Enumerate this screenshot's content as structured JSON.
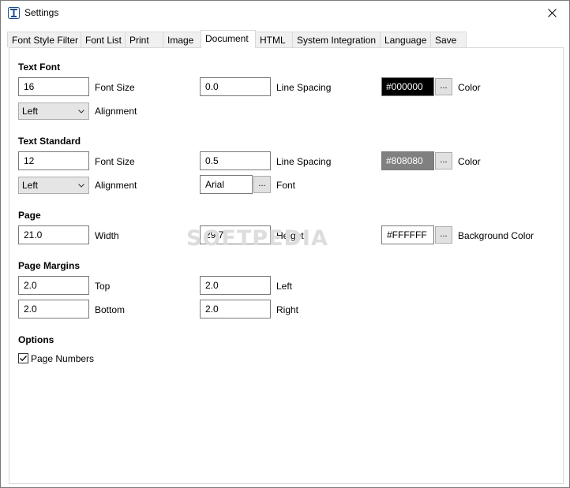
{
  "window": {
    "title": "Settings",
    "icon": "app-icon",
    "close_icon": "close-icon"
  },
  "tabs": [
    {
      "label": "Font Style Filter",
      "active": false
    },
    {
      "label": "Font List",
      "active": false
    },
    {
      "label": "Print",
      "active": false
    },
    {
      "label": "Image",
      "active": false
    },
    {
      "label": "Document",
      "active": true
    },
    {
      "label": "HTML",
      "active": false
    },
    {
      "label": "System Integration",
      "active": false
    },
    {
      "label": "Language",
      "active": false
    },
    {
      "label": "Save",
      "active": false
    }
  ],
  "text_font": {
    "title": "Text Font",
    "font_size": "16",
    "font_size_label": "Font Size",
    "line_spacing": "0.0",
    "line_spacing_label": "Line Spacing",
    "color": "#000000",
    "color_label": "Color",
    "alignment": "Left",
    "alignment_label": "Alignment",
    "ellipsis": "..."
  },
  "text_standard": {
    "title": "Text Standard",
    "font_size": "12",
    "font_size_label": "Font Size",
    "line_spacing": "0.5",
    "line_spacing_label": "Line Spacing",
    "color": "#808080",
    "color_label": "Color",
    "alignment": "Left",
    "alignment_label": "Alignment",
    "font": "Arial",
    "font_label": "Font",
    "ellipsis": "..."
  },
  "page": {
    "title": "Page",
    "width": "21.0",
    "width_label": "Width",
    "height": "29.7",
    "height_label": "Height",
    "background_color": "#FFFFFF",
    "background_color_label": "Background Color",
    "ellipsis": "..."
  },
  "page_margins": {
    "title": "Page Margins",
    "top": "2.0",
    "top_label": "Top",
    "left": "2.0",
    "left_label": "Left",
    "bottom": "2.0",
    "bottom_label": "Bottom",
    "right": "2.0",
    "right_label": "Right"
  },
  "options": {
    "title": "Options",
    "page_numbers_label": "Page Numbers",
    "page_numbers_checked": true
  },
  "watermark": "SOFTPEDIA"
}
